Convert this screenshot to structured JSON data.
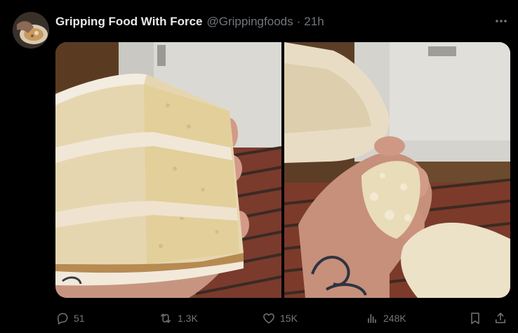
{
  "author": {
    "display_name": "Gripping Food With Force",
    "handle": "@Grippingfoods",
    "time": "21h"
  },
  "icons": {
    "more": "more-horizontal-icon",
    "reply": "reply-icon",
    "repost": "repost-icon",
    "like": "heart-icon",
    "views": "views-chart-icon",
    "bookmark": "bookmark-icon",
    "share": "share-icon"
  },
  "metrics": {
    "replies": "51",
    "reposts": "1.3K",
    "likes": "15K",
    "views": "248K"
  },
  "colors": {
    "background": "#000000",
    "primary_text": "#e7e9ea",
    "secondary_text": "#71767b"
  }
}
